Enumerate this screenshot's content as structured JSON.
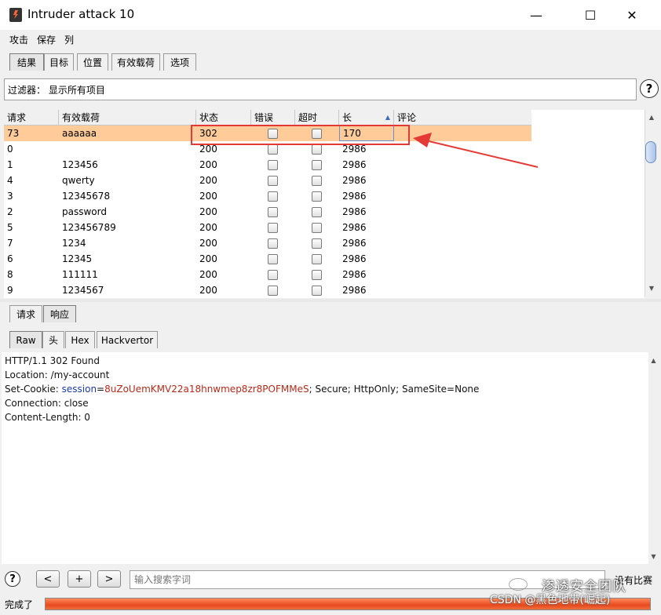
{
  "window": {
    "title": "Intruder attack 10",
    "minimize": "—",
    "maximize": "☐",
    "close": "✕"
  },
  "menu": [
    "攻击",
    "保存",
    "列"
  ],
  "main_tabs": [
    "结果",
    "目标",
    "位置",
    "有效载荷",
    "选项"
  ],
  "filter": {
    "text": "过滤器： 显示所有项目",
    "help": "?"
  },
  "table": {
    "columns": [
      "请求",
      "有效载荷",
      "状态",
      "错误",
      "超时",
      "长",
      "评论"
    ],
    "rows": [
      {
        "req": "73",
        "payload": "aaaaaa",
        "status": "302",
        "len": "170"
      },
      {
        "req": "0",
        "payload": "",
        "status": "200",
        "len": "2986"
      },
      {
        "req": "1",
        "payload": "123456",
        "status": "200",
        "len": "2986"
      },
      {
        "req": "4",
        "payload": "qwerty",
        "status": "200",
        "len": "2986"
      },
      {
        "req": "3",
        "payload": "12345678",
        "status": "200",
        "len": "2986"
      },
      {
        "req": "2",
        "payload": "password",
        "status": "200",
        "len": "2986"
      },
      {
        "req": "5",
        "payload": "123456789",
        "status": "200",
        "len": "2986"
      },
      {
        "req": "7",
        "payload": "1234",
        "status": "200",
        "len": "2986"
      },
      {
        "req": "6",
        "payload": "12345",
        "status": "200",
        "len": "2986"
      },
      {
        "req": "8",
        "payload": "111111",
        "status": "200",
        "len": "2986"
      },
      {
        "req": "9",
        "payload": "1234567",
        "status": "200",
        "len": "2986"
      }
    ]
  },
  "sub_tabs": [
    "请求",
    "响应"
  ],
  "view_tabs": [
    "Raw",
    "头",
    "Hex",
    "Hackvertor"
  ],
  "response": {
    "l1": "HTTP/1.1 302 Found",
    "l2": "Location: /my-account",
    "l3a": "Set-Cookie: ",
    "l3b": "session",
    "l3c": "=",
    "l3d": "8uZoUemKMV22a18hnwmep8zr8POFMMeS",
    "l3e": "; Secure; HttpOnly; SameSite=None",
    "l4": "Connection: close",
    "l5": "Content-Length: 0"
  },
  "bottom": {
    "help": "?",
    "prev": "<",
    "add": "+",
    "next": ">",
    "search_placeholder": "输入搜索字词",
    "match": "没有比赛"
  },
  "status": {
    "text": "完成了"
  },
  "watermark": {
    "line1": "渗透安全团队",
    "line2": "CSDN @黑色地带(崛起)"
  },
  "colors": {
    "selected_row": "#ffcc99",
    "annotation": "#e53935",
    "progress": "#f06a3a"
  }
}
